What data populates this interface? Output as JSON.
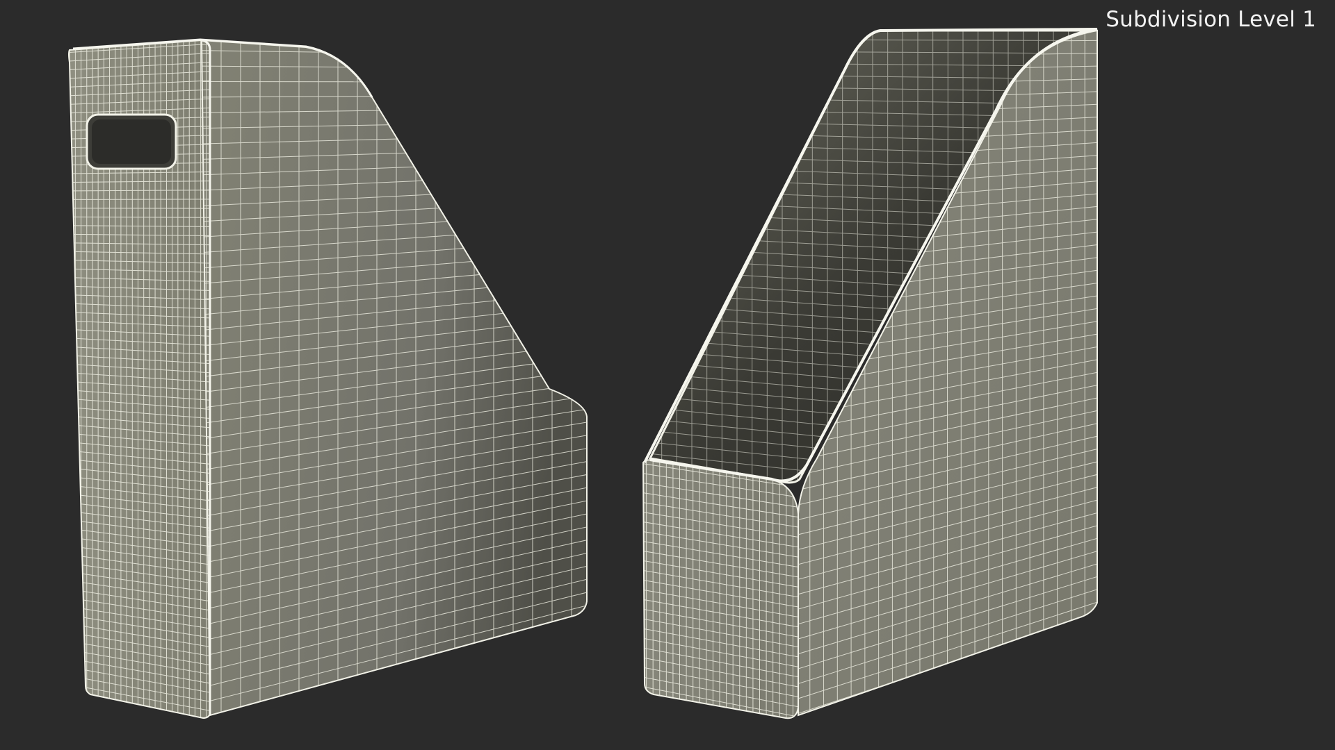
{
  "viewport_label": "Subdivision Level 1",
  "colors": {
    "background": "#2b2b2b",
    "surface_light": "#8b8b7c",
    "surface_dark": "#4f4f47",
    "interior": "#2e2e2a",
    "wire": "#f2f2e8"
  },
  "objects": [
    {
      "name": "magazine-file-left",
      "view": "front-left with handle cutout"
    },
    {
      "name": "magazine-file-right",
      "view": "rear-right showing open interior"
    }
  ]
}
